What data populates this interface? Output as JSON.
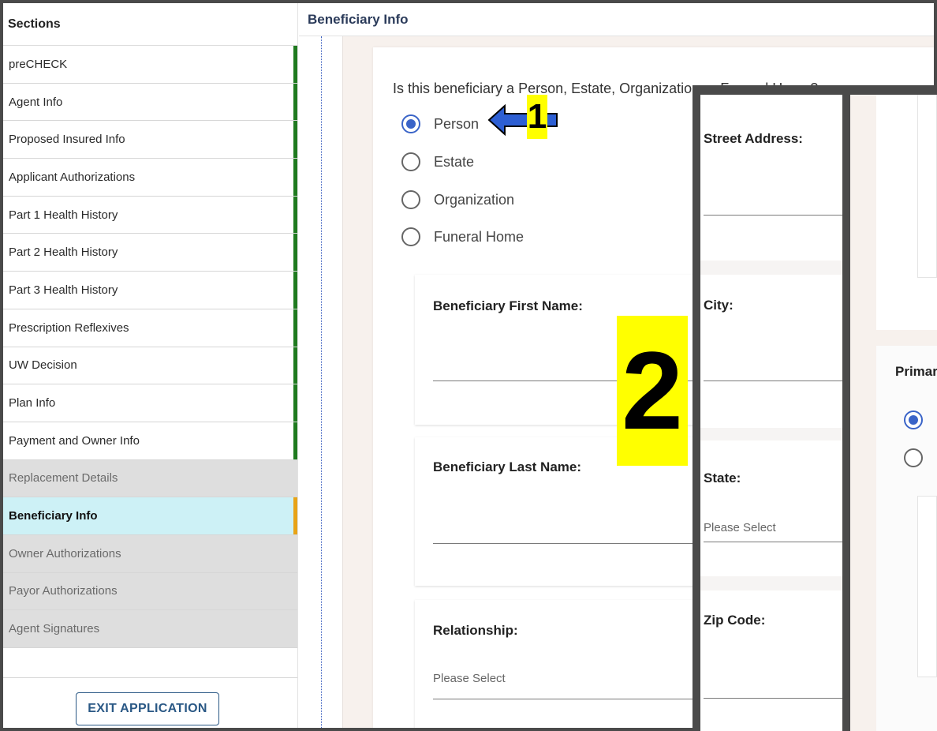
{
  "sidebar": {
    "header": "Sections",
    "items": [
      {
        "label": "preCHECK"
      },
      {
        "label": "Agent Info"
      },
      {
        "label": "Proposed Insured Info"
      },
      {
        "label": "Applicant Authorizations"
      },
      {
        "label": "Part 1 Health History"
      },
      {
        "label": "Part 2 Health History"
      },
      {
        "label": "Part 3 Health History"
      },
      {
        "label": "Prescription Reflexives"
      },
      {
        "label": "UW Decision"
      },
      {
        "label": "Plan Info"
      },
      {
        "label": "Payment and Owner Info"
      },
      {
        "label": "Replacement Details"
      },
      {
        "label": "Beneficiary Info"
      },
      {
        "label": "Owner Authorizations"
      },
      {
        "label": "Payor Authorizations"
      },
      {
        "label": "Agent Signatures"
      }
    ],
    "exit_button": "EXIT APPLICATION"
  },
  "main": {
    "title": "Beneficiary Info",
    "question": "Is this beneficiary a Person, Estate, Organization or Funeral Home?",
    "options": [
      {
        "label": "Person",
        "selected": true
      },
      {
        "label": "Estate",
        "selected": false
      },
      {
        "label": "Organization",
        "selected": false
      },
      {
        "label": "Funeral Home",
        "selected": false
      }
    ],
    "fields": {
      "first_name_label": "Beneficiary First Name:",
      "last_name_label": "Beneficiary Last Name:",
      "relationship_label": "Relationship:",
      "relationship_placeholder": "Please Select"
    }
  },
  "annotations": {
    "marker_1": "1",
    "marker_2": "2",
    "highlight_color": "#ffff00",
    "arrow_color": "#2d5fd3"
  },
  "panel2": {
    "street_label": "Street Address:",
    "city_label": "City:",
    "state_label": "State:",
    "state_placeholder": "Please Select",
    "zip_label": "Zip Code:"
  },
  "panel3": {
    "section_label": "Primar"
  },
  "colors": {
    "completed_indicator": "#1f7a1f",
    "active_indicator": "#e8a317",
    "active_background": "#cdf1f6",
    "radio_accent": "#3a64c8",
    "header_text": "#2b3b5a"
  }
}
